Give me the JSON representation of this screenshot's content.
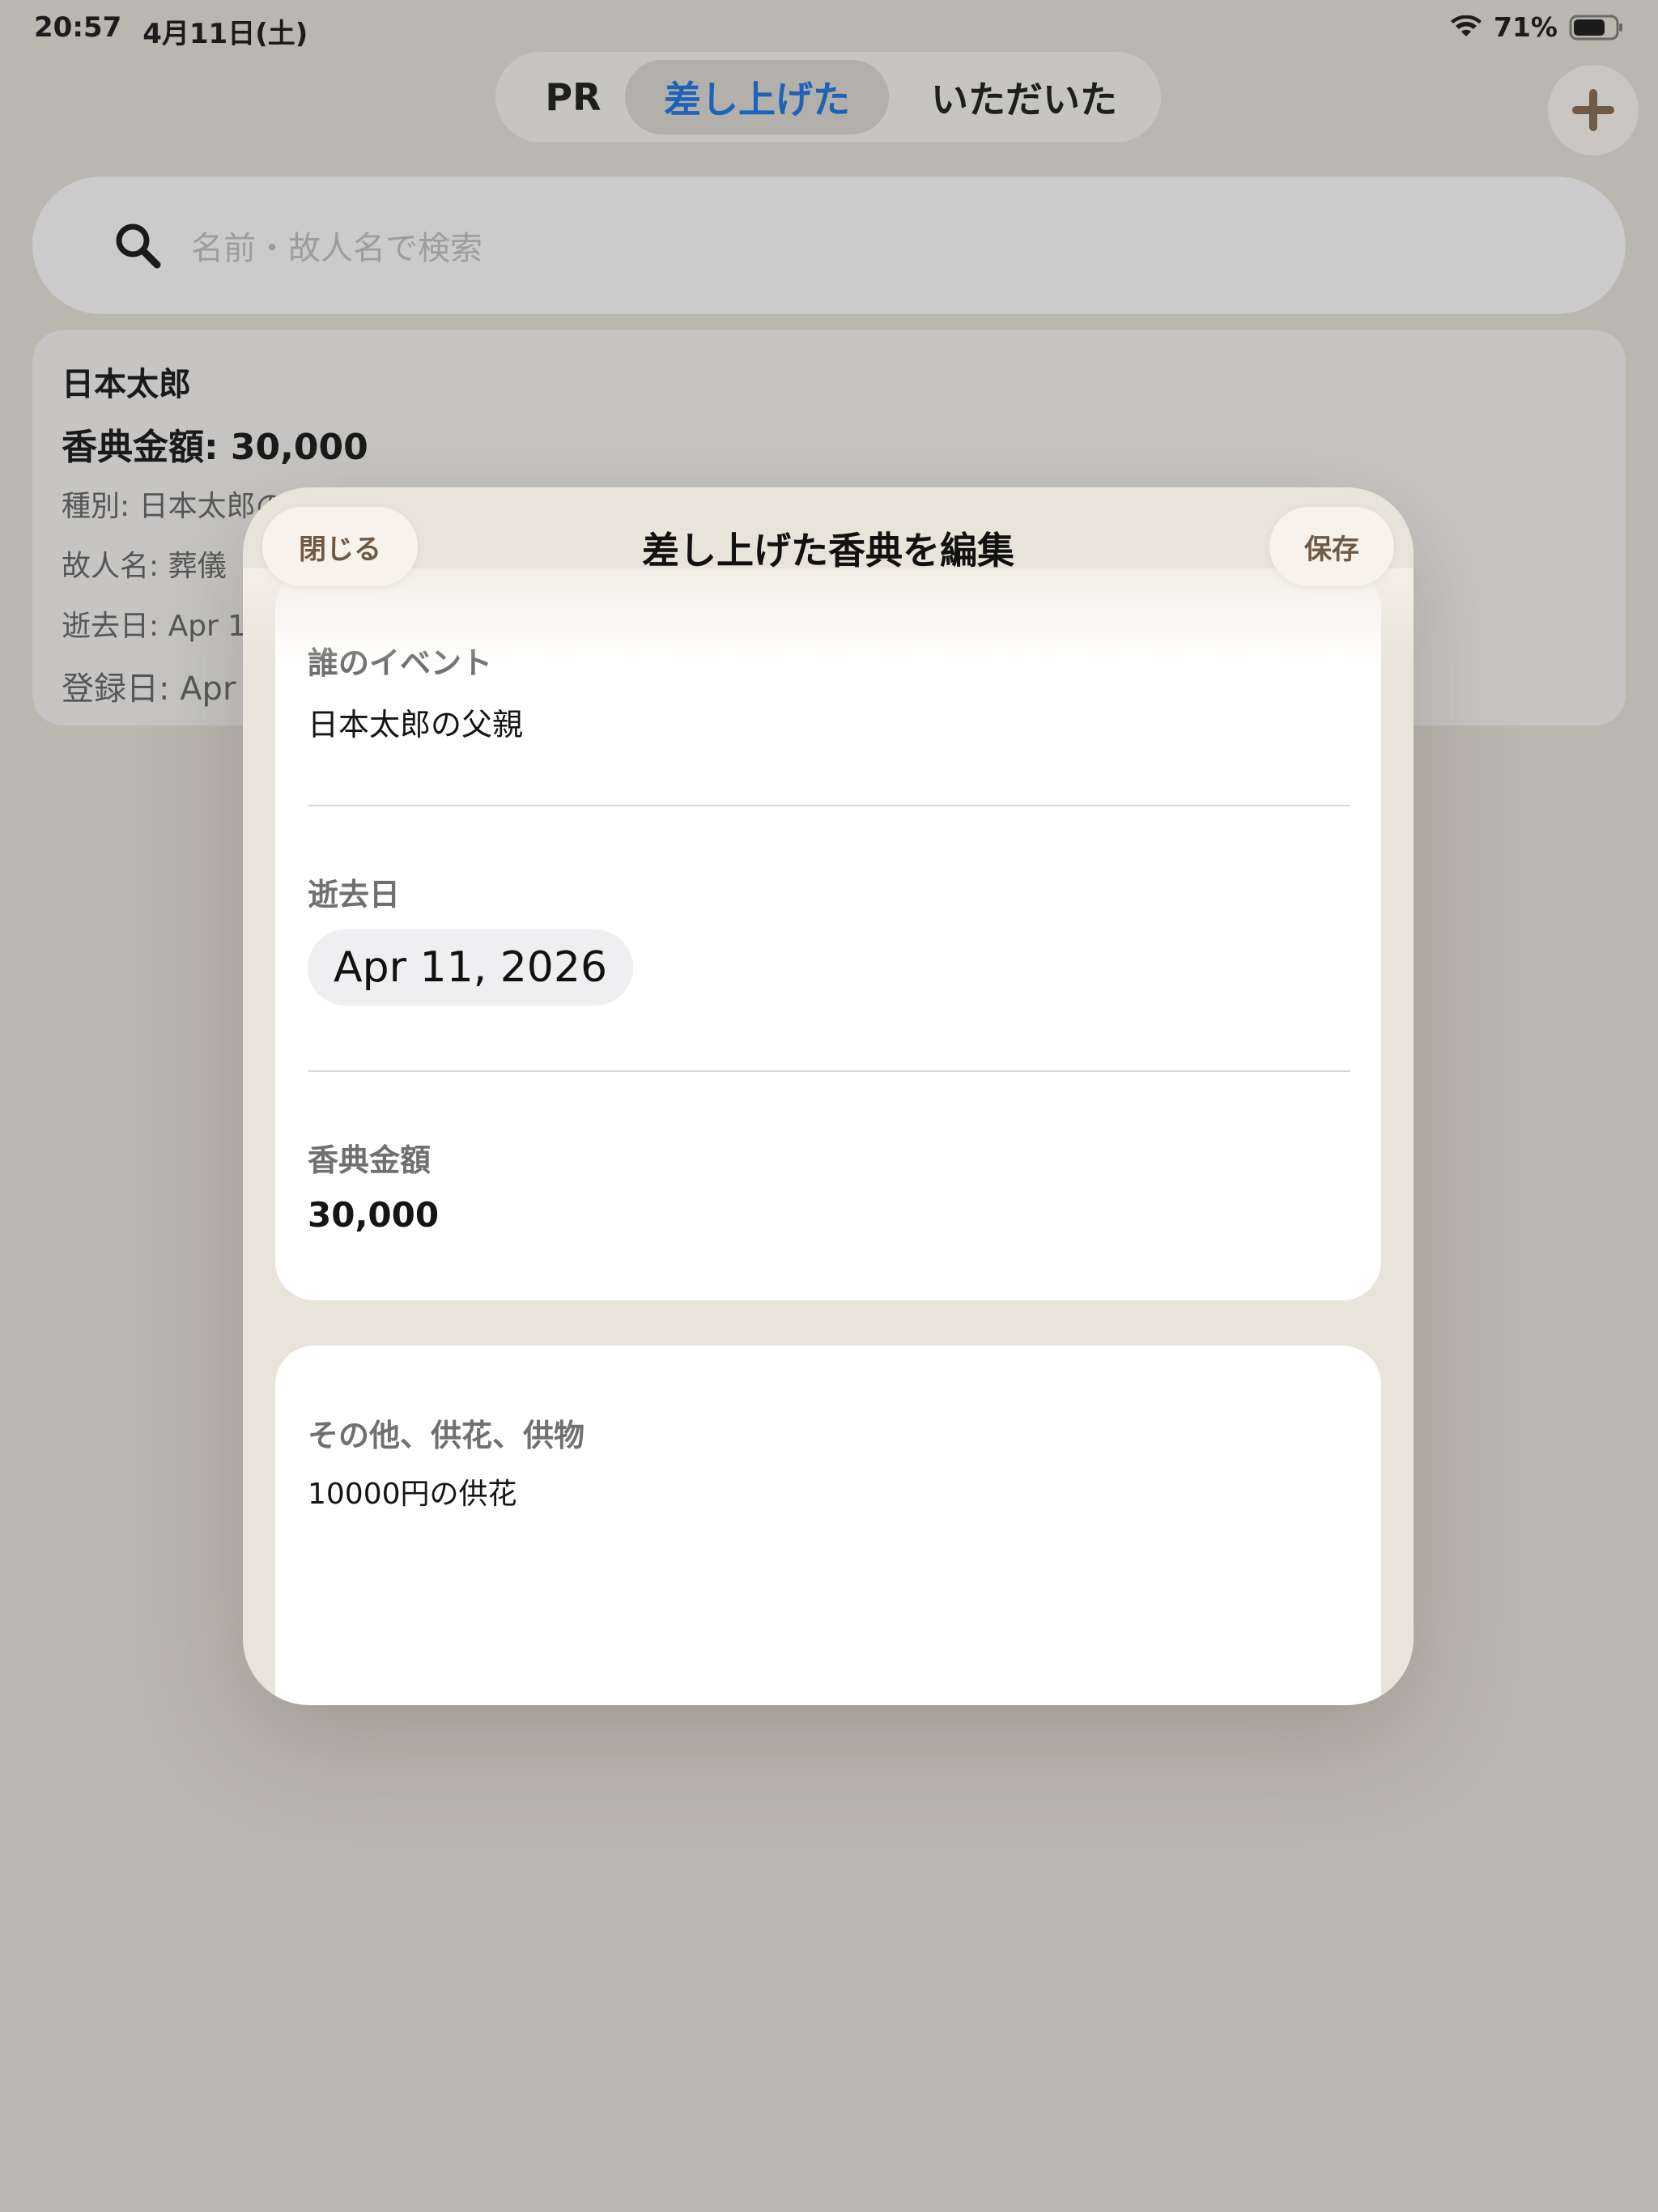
{
  "status_bar": {
    "time": "20:57",
    "date": "4月11日(土)",
    "battery": "71%"
  },
  "segments": {
    "pr": "PR",
    "given": "差し上げた",
    "received": "いただいた",
    "selected": "given",
    "selected_color": "#1d63b6"
  },
  "search": {
    "placeholder": "名前・故人名で検索"
  },
  "record": {
    "name": "日本太郎",
    "amount_line": "香典金額: 30,000",
    "type_line": "種別: 日本太郎の",
    "deceased_line": "故人名: 葬儀",
    "death_line": "逝去日: Apr 1",
    "registered_line": "登録日: Apr"
  },
  "modal": {
    "title": "差し上げた香典を編集",
    "close_label": "閉じる",
    "save_label": "保存",
    "event_label": "誰のイベント",
    "event_value": "日本太郎の父親",
    "death_date_label": "逝去日",
    "death_date_value": "Apr 11, 2026",
    "amount_label": "香典金額",
    "amount_value": "30,000",
    "other_label": "その他、供花、供物",
    "other_value": "10000円の供花"
  },
  "icons": {
    "add": "plus-icon",
    "search": "search-icon",
    "wifi": "wifi-icon",
    "battery": "battery-icon"
  },
  "colors": {
    "accent": "#1d63b6",
    "modal_button_text": "#6f5a45"
  }
}
